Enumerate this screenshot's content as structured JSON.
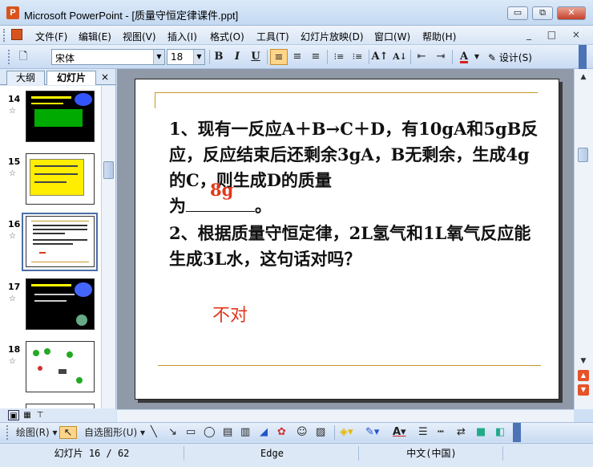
{
  "window": {
    "app_icon": "P",
    "title": "Microsoft PowerPoint - [质量守恒定律课件.ppt]",
    "controls": {
      "minimize": "▭",
      "restore": "⧉",
      "close": "✕"
    }
  },
  "menubar": {
    "items": [
      "文件(F)",
      "编辑(E)",
      "视图(V)",
      "插入(I)",
      "格式(O)",
      "工具(T)",
      "幻灯片放映(D)",
      "窗口(W)",
      "帮助(H)"
    ],
    "doc_controls": "_ □ ×"
  },
  "format_toolbar": {
    "font_name": "宋体",
    "font_size": "18",
    "bold": "B",
    "italic": "I",
    "underline": "U",
    "align_left": "≡",
    "align_center": "≡",
    "align_right": "≡",
    "numbered_list": "⁝≡",
    "bullet_list": "⁝≡",
    "grow_font": "A↑",
    "shrink_font": "A↓",
    "decrease_indent": "⇤",
    "increase_indent": "⇥",
    "font_color": "A",
    "design_label": "设计(S)",
    "font_color_value": "#d92020"
  },
  "left_pane": {
    "tab_outline": "大纲",
    "tab_slides": "幻灯片",
    "close": "×",
    "slides": [
      {
        "number": "14",
        "background": "black"
      },
      {
        "number": "15",
        "background": "white"
      },
      {
        "number": "16",
        "background": "white",
        "selected": true
      },
      {
        "number": "17",
        "background": "black"
      },
      {
        "number": "18",
        "background": "white"
      }
    ]
  },
  "slide": {
    "question1_part1": "1、现有一反应A＋B→C＋D，有10gA和5gB反应，反应结束后还剩余3gA，B无剩余，生成4g的C，则生成D的质量",
    "question1_part2_prefix": "为",
    "question1_part2_suffix": "。",
    "answer1": "8g",
    "question2": "2、根据质量守恒定律，2L氢气和1L氧气反应能生成3L水，这句话对吗？",
    "answer2": "不对",
    "accent_color": "#c79a25",
    "answer_color": "#e2361c"
  },
  "drawing_toolbar": {
    "draw_label": "绘图(R)",
    "autoshapes_label": "自选图形(U)"
  },
  "statusbar": {
    "slide_info": "幻灯片 16 / 62",
    "template": "Edge",
    "language": "中文(中国)"
  }
}
